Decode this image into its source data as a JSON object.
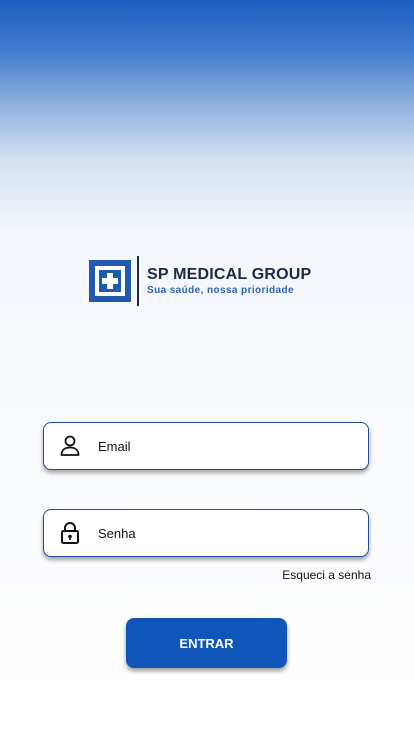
{
  "logo": {
    "title": "SP MEDICAL GROUP",
    "tagline": "Sua saúde, nossa prioridade",
    "brand_color": "#1f59b0",
    "text_color": "#1b2a45"
  },
  "login": {
    "email_placeholder": "Email",
    "email_value": "",
    "password_placeholder": "Senha",
    "password_value": "",
    "email_icon": "user-icon",
    "password_icon": "lock-icon",
    "forgot_label": "Esqueci a senha",
    "submit_label": "ENTRAR"
  },
  "colors": {
    "accent": "#0f56b8",
    "field_border": "#1f4e9a"
  }
}
